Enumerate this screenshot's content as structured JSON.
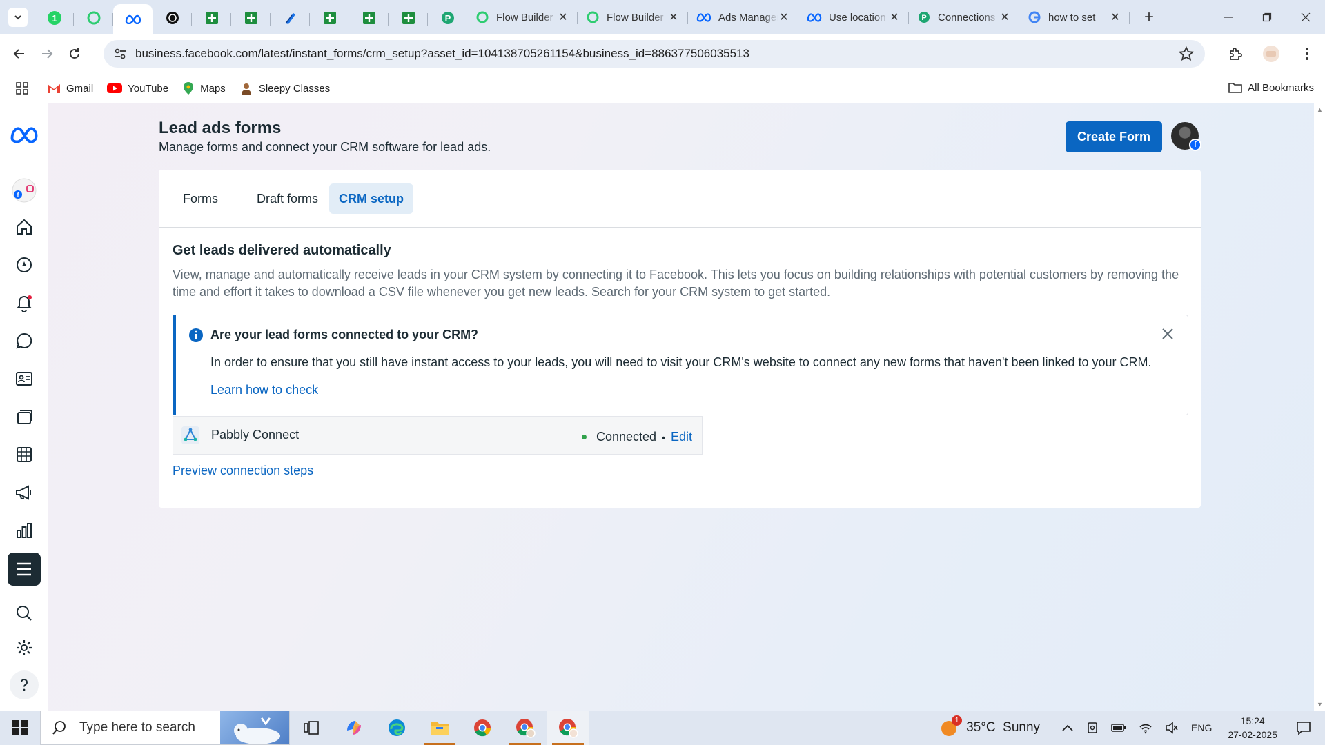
{
  "browser": {
    "pinned_tabs": [
      {
        "icon": "whatsapp-badge-icon"
      },
      {
        "icon": "chat-bubble-icon"
      },
      {
        "icon": "meta-icon",
        "active": true
      },
      {
        "icon": "openai-icon"
      },
      {
        "icon": "sheets-icon"
      },
      {
        "icon": "sheets-icon"
      },
      {
        "icon": "pen-icon"
      },
      {
        "icon": "sheets-icon"
      },
      {
        "icon": "sheets-icon"
      },
      {
        "icon": "sheets-icon"
      },
      {
        "icon": "pabbly-icon"
      }
    ],
    "tabs": [
      {
        "title": "Flow Builder",
        "icon": "chat-bubble-icon"
      },
      {
        "title": "Flow Builder",
        "icon": "chat-bubble-icon"
      },
      {
        "title": "Ads Manager",
        "icon": "meta-icon"
      },
      {
        "title": "Use location",
        "icon": "meta-icon"
      },
      {
        "title": "Connections",
        "icon": "pabbly-icon"
      },
      {
        "title": "how to set",
        "icon": "google-icon"
      }
    ],
    "new_tab_label": "+",
    "url": "business.facebook.com/latest/instant_forms/crm_setup?asset_id=104138705261154&business_id=886377506035513",
    "bookmarks": [
      {
        "label": "Gmail",
        "icon": "gmail-icon"
      },
      {
        "label": "YouTube",
        "icon": "youtube-icon"
      },
      {
        "label": "Maps",
        "icon": "maps-icon"
      },
      {
        "label": "Sleepy Classes",
        "icon": "sleepy-classes-icon"
      }
    ],
    "all_bookmarks_label": "All Bookmarks"
  },
  "header": {
    "title": "Lead ads forms",
    "subtitle": "Manage forms and connect your CRM software for lead ads.",
    "create_button": "Create Form"
  },
  "page_tabs": [
    {
      "label": "Forms"
    },
    {
      "label": "Draft forms"
    },
    {
      "label": "CRM setup",
      "active": true
    }
  ],
  "section": {
    "title": "Get leads delivered automatically",
    "description": "View, manage and automatically receive leads in your CRM system by connecting it to Facebook. This lets you focus on building relationships with potential customers by removing the time and effort it takes to download a CSV file whenever you get new leads. Search for your CRM system to get started."
  },
  "notice": {
    "title": "Are your lead forms connected to your CRM?",
    "body": "In order to ensure that you still have instant access to your leads, you will need to visit your CRM's website to connect any new forms that haven't been linked to your CRM.",
    "link": "Learn how to check"
  },
  "crm": {
    "name": "Pabbly Connect",
    "status": "Connected",
    "separator": "•",
    "edit": "Edit",
    "status_color": "#31a24c"
  },
  "preview_link": "Preview connection steps",
  "taskbar": {
    "search_placeholder": "Type here to search",
    "weather": "35°C  Sunny",
    "weather_badge": "1",
    "language": "ENG",
    "time": "15:24",
    "date": "27-02-2025"
  },
  "colors": {
    "accent": "#0a66c2",
    "text": "#1c2b33",
    "muted": "#5f6b75"
  }
}
